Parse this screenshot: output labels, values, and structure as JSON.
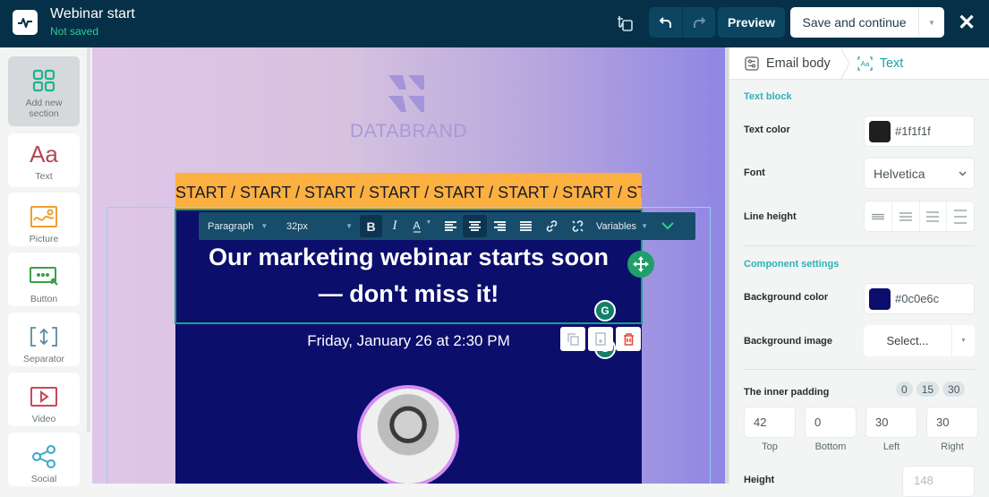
{
  "header": {
    "title": "Webinar start",
    "status": "Not saved",
    "preview_label": "Preview",
    "save_label": "Save and continue",
    "icons": [
      "app-logo-icon",
      "language-icon",
      "undo-icon",
      "redo-icon",
      "chevron-down-icon",
      "close-icon"
    ]
  },
  "sidebar": {
    "items": [
      {
        "label": "Add new section",
        "icon": "grid-icon",
        "active": true
      },
      {
        "label": "Text",
        "icon": "text-aa-icon"
      },
      {
        "label": "Picture",
        "icon": "picture-icon"
      },
      {
        "label": "Button",
        "icon": "button-icon"
      },
      {
        "label": "Separator",
        "icon": "separator-icon"
      },
      {
        "label": "Video",
        "icon": "video-icon"
      },
      {
        "label": "Social",
        "icon": "share-icon"
      }
    ]
  },
  "canvas": {
    "brand_name": "DATABRAND",
    "marquee_text": "START / START / START / START / START / START / START / START / START",
    "headline_line1": "Our marketing webinar starts soon",
    "headline_line2": "— don't miss it!",
    "date_text": "Friday, January 26 at 2:30 PM",
    "colors": {
      "marquee_bg": "#fbb040",
      "block_bg": "#0c0e6c",
      "selection": "#16a085"
    },
    "toolbar": {
      "block_type": "Paragraph",
      "font_size": "32px",
      "variables_label": "Variables",
      "tools": [
        "bold",
        "italic",
        "text-color",
        "align-left",
        "align-center",
        "align-right",
        "align-justify",
        "link",
        "unlink"
      ]
    }
  },
  "panel": {
    "breadcrumb": {
      "parent": "Email body",
      "current": "Text"
    },
    "text_block": {
      "title": "Text block",
      "text_color_label": "Text color",
      "text_color_value": "#1f1f1f",
      "font_label": "Font",
      "font_value": "Helvetica",
      "line_height_label": "Line height"
    },
    "component": {
      "title": "Component settings",
      "bg_color_label": "Background color",
      "bg_color_value": "#0c0e6c",
      "bg_image_label": "Background image",
      "bg_image_value": "Select..."
    },
    "padding": {
      "label": "The inner padding",
      "presets": [
        "0",
        "15",
        "30"
      ],
      "top": "42",
      "bottom": "0",
      "left": "30",
      "right": "30",
      "captions": {
        "top": "Top",
        "bottom": "Bottom",
        "left": "Left",
        "right": "Right"
      }
    },
    "height": {
      "label": "Height",
      "placeholder": "148"
    }
  }
}
